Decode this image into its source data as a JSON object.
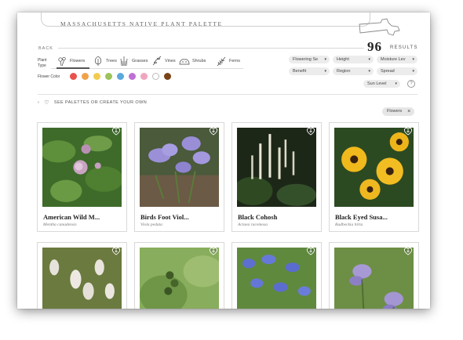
{
  "header": {
    "title": "MASSACHUSETTS NATIVE PLANT PALETTE",
    "back_label": "BACK",
    "result_count": "96",
    "result_label": "RESULTS"
  },
  "plant_type": {
    "label": "Plant Type",
    "options": [
      {
        "label": "Flowers",
        "icon": "flowers-icon",
        "active": true
      },
      {
        "label": "Trees",
        "icon": "tree-icon",
        "active": false
      },
      {
        "label": "Grasses",
        "icon": "grass-icon",
        "active": false
      },
      {
        "label": "Vines",
        "icon": "vine-icon",
        "active": false
      },
      {
        "label": "Shrubs",
        "icon": "shrub-icon",
        "active": false
      },
      {
        "label": "Ferns",
        "icon": "fern-icon",
        "active": false
      }
    ]
  },
  "flower_color": {
    "label": "Flower Color",
    "swatches": [
      "#e8524a",
      "#f0a24a",
      "#f3cc4f",
      "#9bc45a",
      "#5ba8dd",
      "#c070d4",
      "#f0a6bd",
      "#ffffff",
      "#7a4418"
    ]
  },
  "filters": {
    "flowering_season": "Flowering Se",
    "height": "Height",
    "moisture": "Moisture Lev",
    "benefit": "Benefit",
    "region": "Region",
    "spread": "Spread",
    "sun_level": "Sun Level",
    "help": "?"
  },
  "palettes": {
    "label": "SEE PALETTES OR CREATE YOUR OWN"
  },
  "active_filter": {
    "label": "Flowers",
    "remove": "×"
  },
  "plants": [
    {
      "name": "American Wild M...",
      "latin": "Mentha canadensis"
    },
    {
      "name": "Birds Foot Viol...",
      "latin": "Viola pedata"
    },
    {
      "name": "Black Cohosh",
      "latin": "Actaea racemosa"
    },
    {
      "name": "Black Eyed Susa...",
      "latin": "Rudbeckia hirta"
    },
    {
      "name": "",
      "latin": ""
    },
    {
      "name": "",
      "latin": ""
    },
    {
      "name": "",
      "latin": ""
    },
    {
      "name": "",
      "latin": ""
    }
  ],
  "colors": {
    "accent": "#333333",
    "chip_bg": "#e6e6e6",
    "dropdown_bg": "#ececec"
  }
}
